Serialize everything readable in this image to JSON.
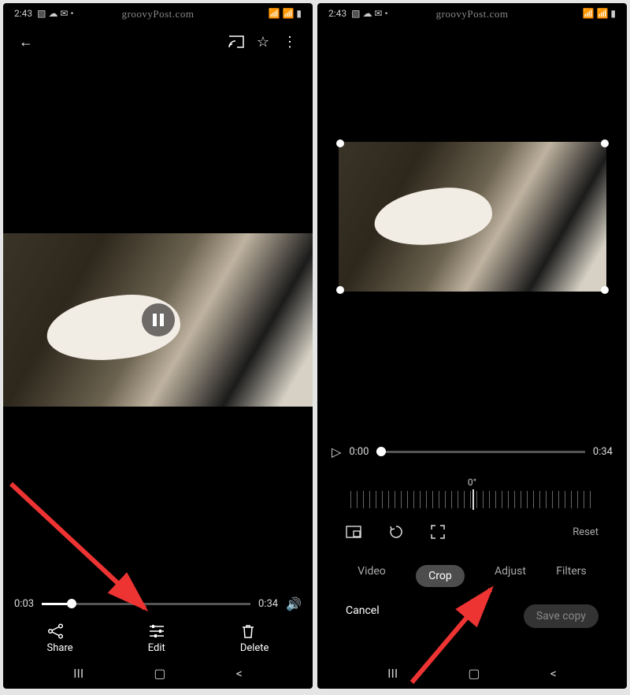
{
  "statusbar": {
    "time": "2:43"
  },
  "watermark": "groovyPost.com",
  "viewer": {
    "playhead_time": "0:03",
    "duration": "0:34",
    "progress_pct": 12,
    "actions": {
      "share": "Share",
      "edit": "Edit",
      "delete": "Delete"
    }
  },
  "editor": {
    "playhead_time": "0:00",
    "duration": "0:34",
    "rotation_label": "0°",
    "tool_icons": {
      "aspect": "aspect-icon",
      "rotate": "rotate-icon",
      "expand": "expand-icon"
    },
    "reset": "Reset",
    "tabs": [
      "Video",
      "Crop",
      "Adjust",
      "Filters"
    ],
    "active_tab": "Crop",
    "cancel": "Cancel",
    "save": "Save copy"
  }
}
